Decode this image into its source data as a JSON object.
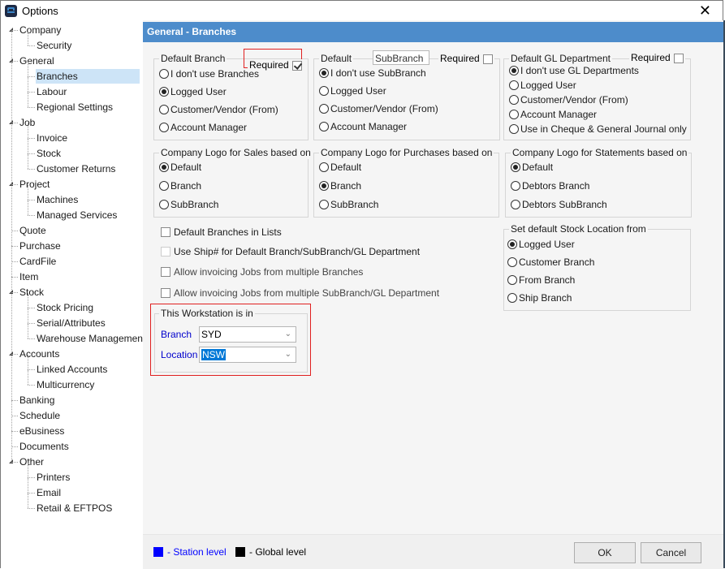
{
  "window": {
    "title": "Options",
    "close_label": "✕"
  },
  "tree": {
    "items": [
      {
        "label": "Company",
        "level": 0,
        "expandable": true
      },
      {
        "label": "Security",
        "level": 1
      },
      {
        "label": "General",
        "level": 0,
        "expandable": true
      },
      {
        "label": "Branches",
        "level": 1,
        "selected": true
      },
      {
        "label": "Labour",
        "level": 1
      },
      {
        "label": "Regional Settings",
        "level": 1
      },
      {
        "label": "Job",
        "level": 0,
        "expandable": true
      },
      {
        "label": "Invoice",
        "level": 1
      },
      {
        "label": "Stock",
        "level": 1
      },
      {
        "label": "Customer Returns",
        "level": 1
      },
      {
        "label": "Project",
        "level": 0,
        "expandable": true
      },
      {
        "label": "Machines",
        "level": 1
      },
      {
        "label": "Managed Services",
        "level": 1
      },
      {
        "label": "Quote",
        "level": 0
      },
      {
        "label": "Purchase",
        "level": 0
      },
      {
        "label": "CardFile",
        "level": 0
      },
      {
        "label": "Item",
        "level": 0
      },
      {
        "label": "Stock",
        "level": 0,
        "expandable": true
      },
      {
        "label": "Stock Pricing",
        "level": 1
      },
      {
        "label": "Serial/Attributes",
        "level": 1
      },
      {
        "label": "Warehouse Management",
        "level": 1
      },
      {
        "label": "Accounts",
        "level": 0,
        "expandable": true
      },
      {
        "label": "Linked Accounts",
        "level": 1
      },
      {
        "label": "Multicurrency",
        "level": 1
      },
      {
        "label": "Banking",
        "level": 0
      },
      {
        "label": "Schedule",
        "level": 0
      },
      {
        "label": "eBusiness",
        "level": 0
      },
      {
        "label": "Documents",
        "level": 0
      },
      {
        "label": "Other",
        "level": 0,
        "expandable": true
      },
      {
        "label": "Printers",
        "level": 1
      },
      {
        "label": "Email",
        "level": 1
      },
      {
        "label": "Retail & EFTPOS",
        "level": 1
      }
    ]
  },
  "header": {
    "title": "General - Branches"
  },
  "default_branch": {
    "legend": "Default Branch",
    "required_label": "Required",
    "required_checked": true,
    "options": [
      "I don't use Branches",
      "Logged User",
      "Customer/Vendor (From)",
      "Account Manager"
    ],
    "selected": 1
  },
  "default_subbranch": {
    "legend": "Default",
    "name_value": "SubBranch",
    "required_label": "Required",
    "required_checked": false,
    "options": [
      "I don't use SubBranch",
      "Logged User",
      "Customer/Vendor (From)",
      "Account Manager"
    ],
    "selected": 0
  },
  "default_gl": {
    "legend": "Default GL Department",
    "required_label": "Required",
    "required_checked": false,
    "options": [
      "I don't use GL Departments",
      "Logged User",
      "Customer/Vendor (From)",
      "Account Manager",
      "Use in Cheque & General Journal only"
    ],
    "selected": 0
  },
  "logo_sales": {
    "legend": "Company Logo for Sales based on",
    "options": [
      "Default",
      "Branch",
      "SubBranch"
    ],
    "selected": 0
  },
  "logo_purchases": {
    "legend": "Company Logo for Purchases based on",
    "options": [
      "Default",
      "Branch",
      "SubBranch"
    ],
    "selected": 1
  },
  "logo_statements": {
    "legend": "Company Logo for Statements based on",
    "options": [
      "Default",
      "Debtors Branch",
      "Debtors SubBranch"
    ],
    "selected": 0
  },
  "stock_location": {
    "legend": "Set default Stock Location from",
    "options": [
      "Logged User",
      "Customer Branch",
      "From Branch",
      "Ship Branch"
    ],
    "selected": 0
  },
  "checkboxes": [
    {
      "label": "Default Branches in Lists",
      "checked": false
    },
    {
      "label": "Use Ship# for Default Branch/SubBranch/GL Department",
      "checked": false,
      "disabled": true
    },
    {
      "label": "Allow invoicing Jobs from multiple Branches",
      "checked": false
    },
    {
      "label": "Allow invoicing Jobs from multiple SubBranch/GL Department",
      "checked": false
    }
  ],
  "workstation": {
    "legend": "This Workstation is in",
    "branch_label": "Branch",
    "branch_value": "SYD",
    "location_label": "Location",
    "location_value": "NSW"
  },
  "footer": {
    "station_legend": "- Station level",
    "global_legend": "- Global level",
    "station_color": "#0000ff",
    "global_color": "#000000",
    "ok_label": "OK",
    "cancel_label": "Cancel"
  },
  "colors": {
    "header_bg": "#4d8ccb",
    "selection": "#cde4f7",
    "highlight_box": "#e02020"
  }
}
